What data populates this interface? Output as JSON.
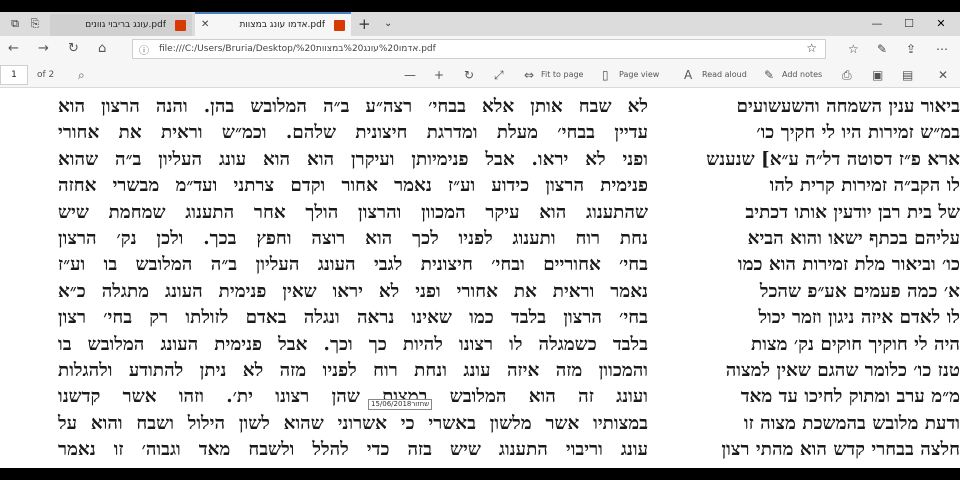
{
  "tabs": [
    {
      "title": "עונג בריבוי גוונים.pdf",
      "active": false
    },
    {
      "title": "אדמו עונג במצוות.pdf",
      "active": true
    }
  ],
  "tab_actions": {
    "new_tab": "+",
    "tab_list": "⌄"
  },
  "window": {
    "minimize": "—",
    "maximize": "☐",
    "close": "✕"
  },
  "address": {
    "url": "file:///C:/Users/Bruria/Desktop/אדמו%20עונג%20במצוות%20.pdf"
  },
  "pdf_toolbar": {
    "page": "1",
    "page_count": "of 2",
    "fit_to_page": "Fit to page",
    "page_view": "Page view",
    "read_aloud": "Read aloud",
    "add_notes": "Add notes"
  },
  "document": {
    "main_lines": [
      "לא שבח אותן אלא בבחי׳ רצה״ע ב״ה המלובש בהן. והנה הרצון הוא",
      "עדיין בבחי׳ מעלת ומדרגת חיצונית שלהם. וכמ״ש וראית את אחורי",
      "ופני לא יראו. אבל פנימיותן ועיקרן הוא הוא עונג העליון ב״ה שהוא",
      "פנימית הרצון כידוע וע״ז נאמר אחור וקדם צרתני ועד״מ מבשרי אחזה",
      "שהתענוג הוא עיקר המכוון והרצון הולך אחר התענוג שמחמת שיש",
      "נחת רוח ותענוג לפניו לכך הוא רוצה וחפץ בכך. ולכן נק׳ הרצון",
      "בחי׳ אחוריים ובחי׳ חיצונית לגבי העונג העליון ב״ה המלובש בו וע״ז",
      "נאמר וראית את אחורי ופני לא יראו שאין פנימית העונג מתגלה כ״א",
      "בחי׳ הרצון בלבד כמו שאינו נראה ונגלה באדם לזולתו רק בחי׳ רצון",
      "בלבד כשמגלה לו רצונו להיות כך וכך. אבל פנימית העונג המלובש בו",
      "והמכוון מזה איזה עונג ונחת רוח לפניו מזה לא ניתן להתודע ולהגלות",
      "ועונג זה הוא המלובש במצות שהן רצונו ית׳. וזהו אשר קדשנו",
      "במצותיו אשר מלשון באשרי כי אשרוני שהוא לשון הילול ושבח והוא על",
      "עונג וריבוי התענוג שיש בזה כדי להלל ולשבח מאד וגבוה׳ זו נאמר"
    ],
    "side_lines": [
      "ביאור ענין השמחה והשעשועים",
      "במ״ש זמירות היו לי חקיך כו׳",
      "ארא פ״ז דסוטה דל״ה ע״א] שנענש",
      "לו הקב״ה זמירות קרית להו",
      "של בית רבן יודעין אותו דכתיב",
      "עליהם בכתף ישאו והוא הביא",
      "כו׳ וביאור מלת זמירות הוא כמו",
      "א׳ כמה פעמים אע״פ שהכל",
      "לו לאדם איזה ניגון וזמר יכול",
      "היה לי חוקיך חוקים נק׳ מצות",
      "טנז כו׳ כלומר שהגם שאין למצוה",
      "מ״מ ערב ומתוק לחיכו עד מאד",
      "ודעת מלובש בהמשכת מצוה זו",
      "חלצה בבחרי קדש הוא מהתי רצון"
    ],
    "stamp": "15/06/2018שחזור"
  }
}
